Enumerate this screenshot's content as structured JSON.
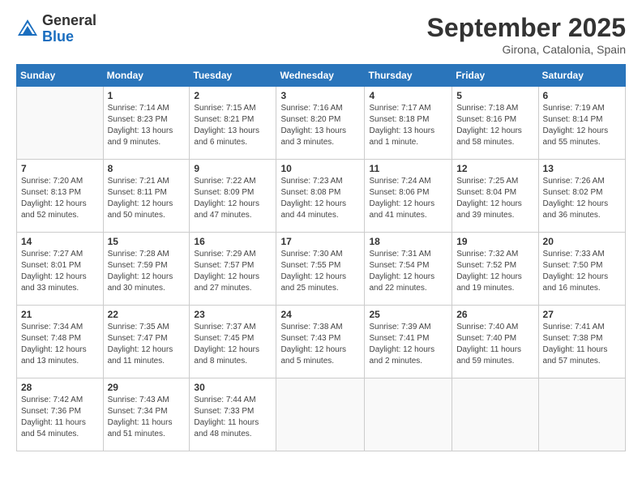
{
  "logo": {
    "general": "General",
    "blue": "Blue"
  },
  "title": "September 2025",
  "location": "Girona, Catalonia, Spain",
  "days_of_week": [
    "Sunday",
    "Monday",
    "Tuesday",
    "Wednesday",
    "Thursday",
    "Friday",
    "Saturday"
  ],
  "weeks": [
    [
      {
        "num": "",
        "info": ""
      },
      {
        "num": "1",
        "info": "Sunrise: 7:14 AM\nSunset: 8:23 PM\nDaylight: 13 hours\nand 9 minutes."
      },
      {
        "num": "2",
        "info": "Sunrise: 7:15 AM\nSunset: 8:21 PM\nDaylight: 13 hours\nand 6 minutes."
      },
      {
        "num": "3",
        "info": "Sunrise: 7:16 AM\nSunset: 8:20 PM\nDaylight: 13 hours\nand 3 minutes."
      },
      {
        "num": "4",
        "info": "Sunrise: 7:17 AM\nSunset: 8:18 PM\nDaylight: 13 hours\nand 1 minute."
      },
      {
        "num": "5",
        "info": "Sunrise: 7:18 AM\nSunset: 8:16 PM\nDaylight: 12 hours\nand 58 minutes."
      },
      {
        "num": "6",
        "info": "Sunrise: 7:19 AM\nSunset: 8:14 PM\nDaylight: 12 hours\nand 55 minutes."
      }
    ],
    [
      {
        "num": "7",
        "info": "Sunrise: 7:20 AM\nSunset: 8:13 PM\nDaylight: 12 hours\nand 52 minutes."
      },
      {
        "num": "8",
        "info": "Sunrise: 7:21 AM\nSunset: 8:11 PM\nDaylight: 12 hours\nand 50 minutes."
      },
      {
        "num": "9",
        "info": "Sunrise: 7:22 AM\nSunset: 8:09 PM\nDaylight: 12 hours\nand 47 minutes."
      },
      {
        "num": "10",
        "info": "Sunrise: 7:23 AM\nSunset: 8:08 PM\nDaylight: 12 hours\nand 44 minutes."
      },
      {
        "num": "11",
        "info": "Sunrise: 7:24 AM\nSunset: 8:06 PM\nDaylight: 12 hours\nand 41 minutes."
      },
      {
        "num": "12",
        "info": "Sunrise: 7:25 AM\nSunset: 8:04 PM\nDaylight: 12 hours\nand 39 minutes."
      },
      {
        "num": "13",
        "info": "Sunrise: 7:26 AM\nSunset: 8:02 PM\nDaylight: 12 hours\nand 36 minutes."
      }
    ],
    [
      {
        "num": "14",
        "info": "Sunrise: 7:27 AM\nSunset: 8:01 PM\nDaylight: 12 hours\nand 33 minutes."
      },
      {
        "num": "15",
        "info": "Sunrise: 7:28 AM\nSunset: 7:59 PM\nDaylight: 12 hours\nand 30 minutes."
      },
      {
        "num": "16",
        "info": "Sunrise: 7:29 AM\nSunset: 7:57 PM\nDaylight: 12 hours\nand 27 minutes."
      },
      {
        "num": "17",
        "info": "Sunrise: 7:30 AM\nSunset: 7:55 PM\nDaylight: 12 hours\nand 25 minutes."
      },
      {
        "num": "18",
        "info": "Sunrise: 7:31 AM\nSunset: 7:54 PM\nDaylight: 12 hours\nand 22 minutes."
      },
      {
        "num": "19",
        "info": "Sunrise: 7:32 AM\nSunset: 7:52 PM\nDaylight: 12 hours\nand 19 minutes."
      },
      {
        "num": "20",
        "info": "Sunrise: 7:33 AM\nSunset: 7:50 PM\nDaylight: 12 hours\nand 16 minutes."
      }
    ],
    [
      {
        "num": "21",
        "info": "Sunrise: 7:34 AM\nSunset: 7:48 PM\nDaylight: 12 hours\nand 13 minutes."
      },
      {
        "num": "22",
        "info": "Sunrise: 7:35 AM\nSunset: 7:47 PM\nDaylight: 12 hours\nand 11 minutes."
      },
      {
        "num": "23",
        "info": "Sunrise: 7:37 AM\nSunset: 7:45 PM\nDaylight: 12 hours\nand 8 minutes."
      },
      {
        "num": "24",
        "info": "Sunrise: 7:38 AM\nSunset: 7:43 PM\nDaylight: 12 hours\nand 5 minutes."
      },
      {
        "num": "25",
        "info": "Sunrise: 7:39 AM\nSunset: 7:41 PM\nDaylight: 12 hours\nand 2 minutes."
      },
      {
        "num": "26",
        "info": "Sunrise: 7:40 AM\nSunset: 7:40 PM\nDaylight: 11 hours\nand 59 minutes."
      },
      {
        "num": "27",
        "info": "Sunrise: 7:41 AM\nSunset: 7:38 PM\nDaylight: 11 hours\nand 57 minutes."
      }
    ],
    [
      {
        "num": "28",
        "info": "Sunrise: 7:42 AM\nSunset: 7:36 PM\nDaylight: 11 hours\nand 54 minutes."
      },
      {
        "num": "29",
        "info": "Sunrise: 7:43 AM\nSunset: 7:34 PM\nDaylight: 11 hours\nand 51 minutes."
      },
      {
        "num": "30",
        "info": "Sunrise: 7:44 AM\nSunset: 7:33 PM\nDaylight: 11 hours\nand 48 minutes."
      },
      {
        "num": "",
        "info": ""
      },
      {
        "num": "",
        "info": ""
      },
      {
        "num": "",
        "info": ""
      },
      {
        "num": "",
        "info": ""
      }
    ]
  ]
}
